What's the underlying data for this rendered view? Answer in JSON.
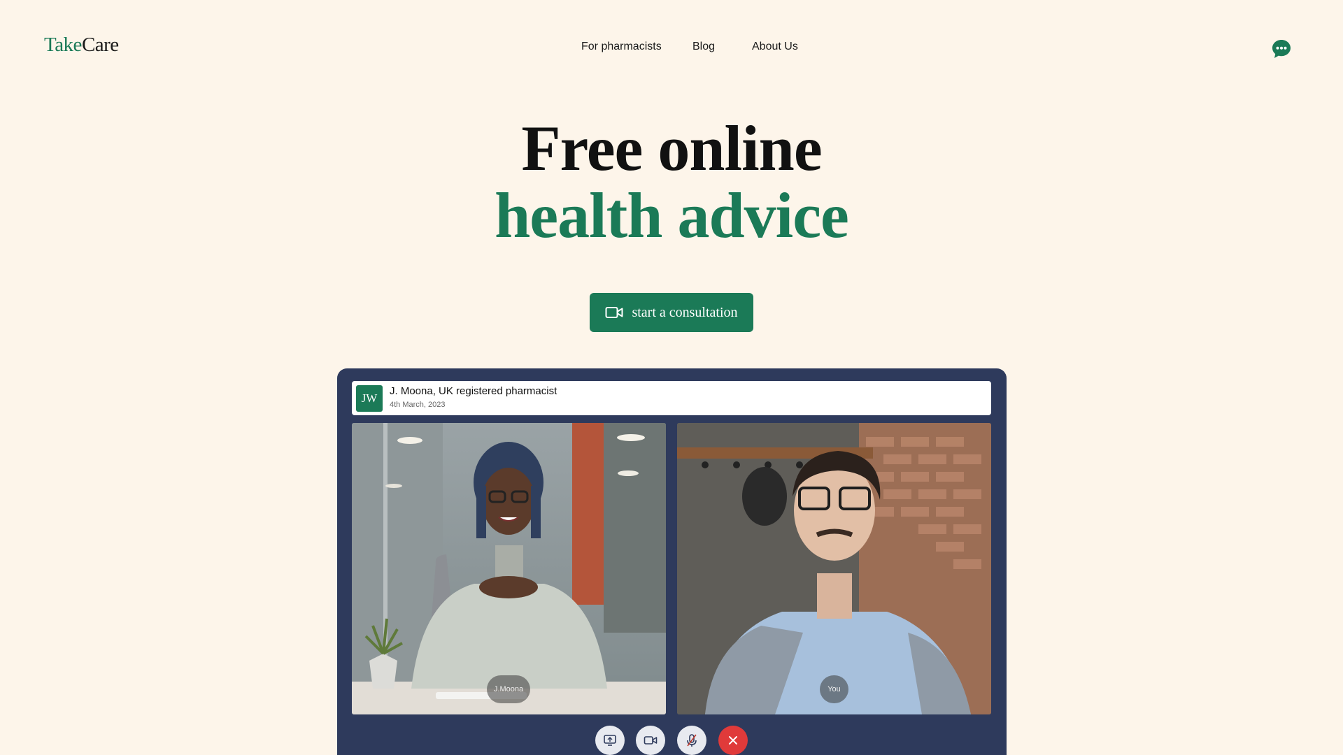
{
  "header": {
    "logo_part1": "Take",
    "logo_part2": "Care",
    "nav": [
      {
        "label": "For pharmacists"
      },
      {
        "label": "Blog"
      },
      {
        "label": "About Us"
      }
    ],
    "chat_icon": "chat-bubble-icon"
  },
  "hero": {
    "title_line1": "Free online",
    "title_line2": "health advice",
    "cta_label": "start a consultation",
    "cta_icon": "video-camera-icon"
  },
  "call": {
    "avatar_initials": "JW",
    "caller_name": "J. Moona, UK registered pharmacist",
    "date": "4th March, 2023",
    "participants": [
      {
        "label": "J.Moona"
      },
      {
        "label": "You"
      }
    ],
    "controls": [
      {
        "icon": "screen-share-icon"
      },
      {
        "icon": "video-camera-icon"
      },
      {
        "icon": "microphone-muted-icon"
      },
      {
        "icon": "end-call-icon"
      }
    ]
  },
  "colors": {
    "background": "#fdf5ea",
    "brand_green": "#1b7a57",
    "panel_navy": "#2e3a5c",
    "end_call_red": "#e03a3a"
  }
}
